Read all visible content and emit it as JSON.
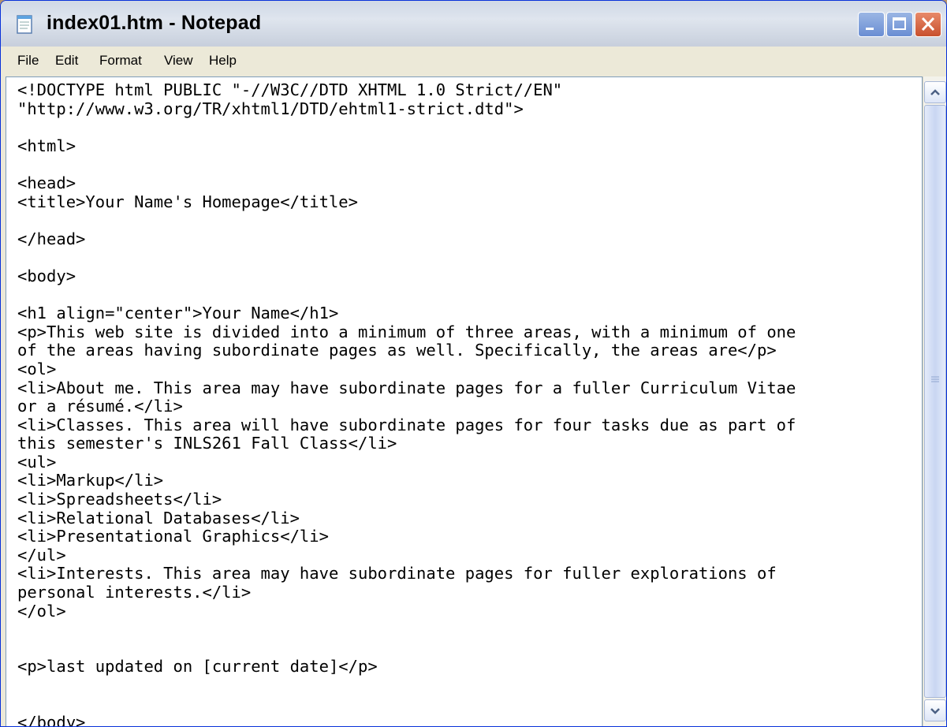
{
  "window": {
    "title": "index01.htm - Notepad",
    "icon": "notepad-icon",
    "controls": [
      "minimize-icon",
      "maximize-icon",
      "close-icon"
    ]
  },
  "menu": [
    {
      "label": "File"
    },
    {
      "label": "Edit"
    },
    {
      "label": "Format"
    },
    {
      "label": "View"
    },
    {
      "label": "Help"
    }
  ],
  "editor": {
    "lines": [
      "<!DOCTYPE html PUBLIC \"-//W3C//DTD XHTML 1.0 Strict//EN\"",
      "\"http://www.w3.org/TR/xhtml1/DTD/ehtml1-strict.dtd\">",
      "",
      "<html>",
      "",
      "<head>",
      "<title>Your Name's Homepage</title>",
      "",
      "</head>",
      "",
      "<body>",
      "",
      "<h1 align=\"center\">Your Name</h1>",
      "<p>This web site is divided into a minimum of three areas, with a minimum of one",
      "of the areas having subordinate pages as well. Specifically, the areas are</p>",
      "<ol>",
      "<li>About me. This area may have subordinate pages for a fuller Curriculum Vitae",
      "or a résumé.</li>",
      "<li>Classes. This area will have subordinate pages for four tasks due as part of",
      "this semester's INLS261 Fall Class</li>",
      "<ul>",
      "<li>Markup</li>",
      "<li>Spreadsheets</li>",
      "<li>Relational Databases</li>",
      "<li>Presentational Graphics</li>",
      "</ul>",
      "<li>Interests. This area may have subordinate pages for fuller explorations of",
      "personal interests.</li>",
      "</ol>",
      "",
      "",
      "<p>last updated on [current date]</p>",
      "",
      "",
      "</body>"
    ]
  },
  "colors": {
    "titlebar": "#dfe5ee",
    "menubar": "#ece9d8",
    "editor_bg": "#ffffff",
    "close_button": "#c8502e",
    "window_button": "#6a8ed3"
  }
}
